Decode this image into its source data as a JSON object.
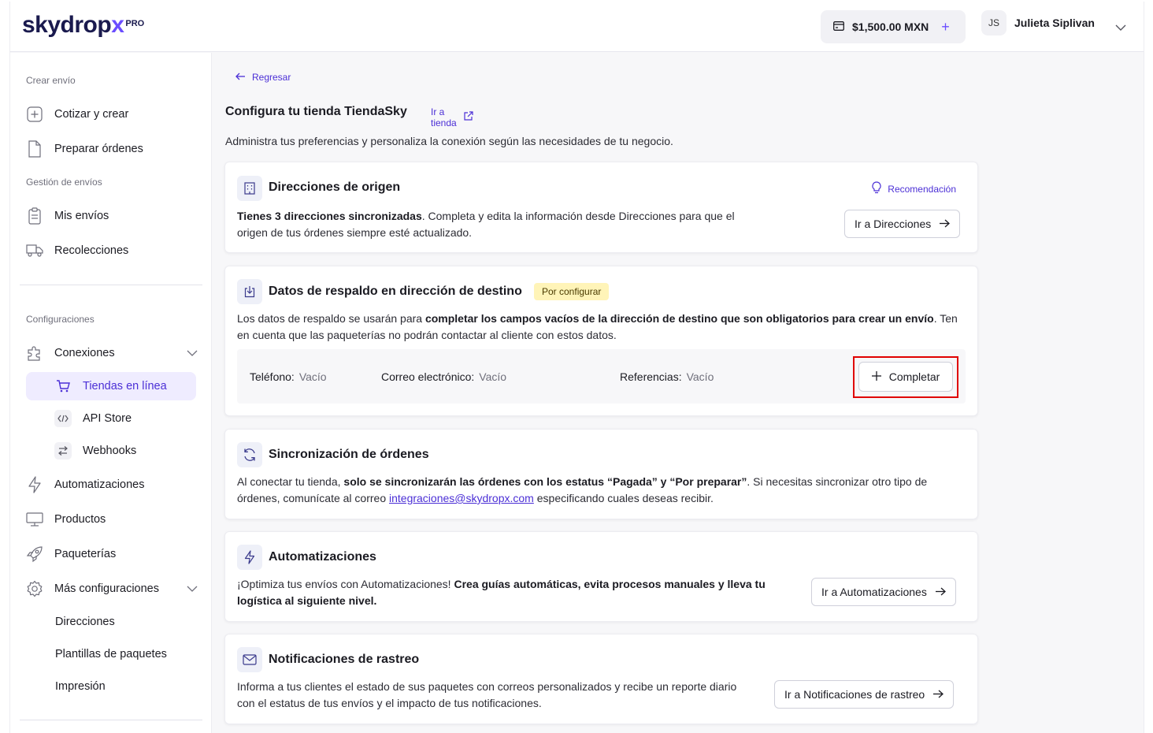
{
  "header": {
    "logo_text": "skydrop",
    "logo_x": "x",
    "logo_badge": "PRO",
    "balance": "$1,500.00 MXN",
    "user_initials": "JS",
    "user_name": "Julieta Siplivan"
  },
  "sidebar": {
    "section_create": "Crear envío",
    "quote_create": "Cotizar y crear",
    "prepare_orders": "Preparar órdenes",
    "section_shipments": "Gestión de envíos",
    "my_shipments": "Mis envíos",
    "pickups": "Recolecciones",
    "section_config": "Configuraciones",
    "connections": "Conexiones",
    "online_stores": "Tiendas en línea",
    "api_store": "API Store",
    "webhooks": "Webhooks",
    "automations": "Automatizaciones",
    "products": "Productos",
    "carriers": "Paqueterías",
    "more_settings": "Más configuraciones",
    "addresses": "Direcciones",
    "package_templates": "Plantillas de paquetes",
    "printing": "Impresión"
  },
  "main": {
    "back": "Regresar",
    "title": "Configura tu tienda TiendaSky",
    "store_link": "Ir a tienda",
    "subtitle": "Administra tus preferencias y personaliza la conexión según las necesidades de tu negocio.",
    "origin": {
      "title": "Direcciones de origen",
      "recommendation": "Recomendación",
      "text_bold": "Tienes 3 direcciones sincronizadas",
      "text_rest": ". Completa y edita la información desde Direcciones para que el origen de tus órdenes siempre esté actualizado.",
      "button": "Ir a Direcciones"
    },
    "backup": {
      "title": "Datos de respaldo en dirección de destino",
      "badge": "Por configurar",
      "text_pre": "Los datos de respaldo se usarán para ",
      "text_bold": "completar los campos vacíos de la dirección de destino que son obligatorios para crear un envío",
      "text_post": ". Ten en cuenta que las paqueterías no podrán contactar al cliente con estos datos.",
      "phone_label": "Teléfono:",
      "phone_value": "Vacío",
      "email_label": "Correo electrónico:",
      "email_value": "Vacío",
      "refs_label": "Referencias:",
      "refs_value": "Vacío",
      "button": "Completar"
    },
    "sync": {
      "title": "Sincronización de órdenes",
      "text_pre": "Al conectar tu tienda, ",
      "text_bold": "solo se sincronizarán las órdenes con los estatus “Pagada” y “Por preparar”",
      "text_mid": ". Si necesitas sincronizar otro tipo de órdenes, comunícate al correo ",
      "email": "integraciones@skydropx.com",
      "text_post": " especificando cuales deseas recibir."
    },
    "automations": {
      "title": "Automatizaciones",
      "text_pre": "¡Optimiza tus envíos con Automatizaciones! ",
      "text_bold": "Crea guías automáticas, evita procesos manuales y lleva tu logística al siguiente nivel.",
      "button": "Ir a Automatizaciones"
    },
    "notifications": {
      "title": "Notificaciones de rastreo",
      "text": "Informa a tus clientes el estado de sus paquetes con correos personalizados y recibe un reporte diario con el estatus de tus envíos y el impacto de tus notificaciones.",
      "button": "Ir a Notificaciones de rastreo"
    }
  }
}
